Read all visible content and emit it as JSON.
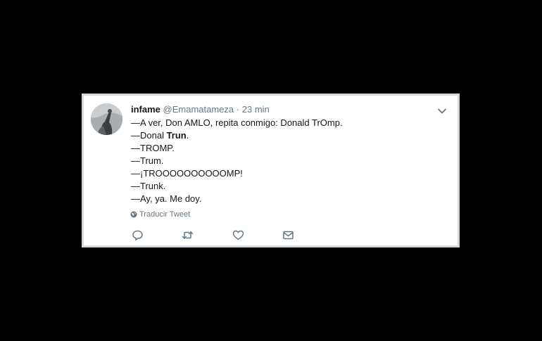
{
  "tweet": {
    "display_name": "infame",
    "handle": "@Emamatameza",
    "separator": "·",
    "time": "23 min",
    "lines": [
      {
        "prefix": "—A ver, Don AMLO, repita conmigo: Donald TrOmp.",
        "bold": "",
        "suffix": ""
      },
      {
        "prefix": "—Donal ",
        "bold": "Trun",
        "suffix": "."
      },
      {
        "prefix": "—TROMP.",
        "bold": "",
        "suffix": ""
      },
      {
        "prefix": "—Trum.",
        "bold": "",
        "suffix": ""
      },
      {
        "prefix": "—¡TROOOOOOOOOOMP!",
        "bold": "",
        "suffix": ""
      },
      {
        "prefix": "—Trunk.",
        "bold": "",
        "suffix": ""
      },
      {
        "prefix": "—Ay, ya. Me doy.",
        "bold": "",
        "suffix": ""
      }
    ],
    "translate_label": "Traducir Tweet"
  },
  "icons": {
    "avatar": "avatar",
    "menu": "chevron-down-icon",
    "translate": "globe-icon",
    "reply": "reply-icon",
    "retweet": "retweet-icon",
    "like": "heart-icon",
    "message": "envelope-icon"
  },
  "colors": {
    "background": "#000000",
    "card": "#ffffff",
    "text": "#14171a",
    "secondary": "#657786"
  }
}
